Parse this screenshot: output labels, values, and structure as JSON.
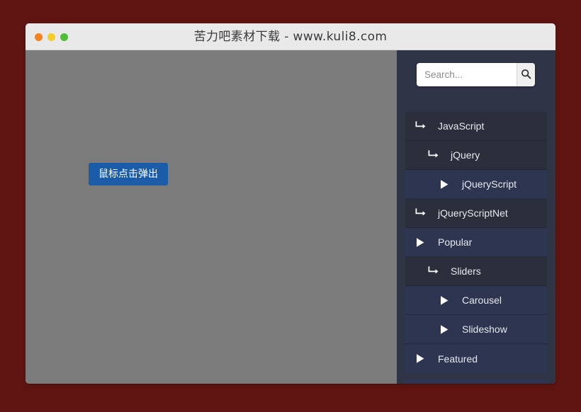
{
  "background": {
    "color": "#5e1512"
  },
  "window": {
    "title": "苦力吧素材下载 - www.kuli8.com",
    "traffic_lights": [
      {
        "name": "close",
        "color": "#f5821f"
      },
      {
        "name": "minimize",
        "color": "#f5cc28"
      },
      {
        "name": "maximize",
        "color": "#4fbf36"
      }
    ]
  },
  "main": {
    "background_color": "#7b7b7b",
    "popup_button": {
      "label": "鼠标点击弹出",
      "color": "#1a5ca8"
    }
  },
  "sidebar": {
    "background_color": "#2f3446",
    "search": {
      "value": "",
      "placeholder": "Search...",
      "button_icon": "search-icon"
    },
    "items": [
      {
        "label": "JavaScript",
        "icon": "arrow-turn-icon",
        "indent": 0,
        "tint": "dark",
        "active": false
      },
      {
        "label": "jQuery",
        "icon": "arrow-turn-icon",
        "indent": 1,
        "tint": "dark",
        "active": false
      },
      {
        "label": "jQueryScript",
        "icon": "play-icon",
        "indent": 2,
        "tint": "blue",
        "active": true
      },
      {
        "label": "jQueryScriptNet",
        "icon": "arrow-turn-icon",
        "indent": 0,
        "tint": "dark",
        "active": false
      },
      {
        "label": "Popular",
        "icon": "play-icon",
        "indent": 0,
        "tint": "blue",
        "active": false
      },
      {
        "label": "Sliders",
        "icon": "arrow-turn-icon",
        "indent": 1,
        "tint": "dark",
        "active": false
      },
      {
        "label": "Carousel",
        "icon": "play-icon",
        "indent": 2,
        "tint": "blue",
        "active": false
      },
      {
        "label": "Slideshow",
        "icon": "play-icon",
        "indent": 2,
        "tint": "blue",
        "active": false
      },
      {
        "label": "Featured",
        "icon": "play-icon",
        "indent": 0,
        "tint": "blue",
        "active": false
      }
    ]
  }
}
